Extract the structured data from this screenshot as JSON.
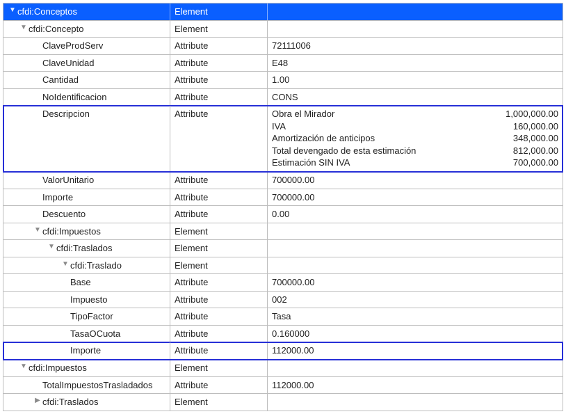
{
  "columns": {
    "c1_header": "cfdi:Conceptos",
    "c2_header": "Element",
    "c3_header": ""
  },
  "rows": [
    {
      "id": "conceptos",
      "indent": 0,
      "arrow": "down",
      "header": true,
      "hl": false,
      "name": "cfdi:Conceptos",
      "type": "Element",
      "value": ""
    },
    {
      "id": "concepto",
      "indent": 1,
      "arrow": "down",
      "header": false,
      "hl": false,
      "name": "cfdi:Concepto",
      "type": "Element",
      "value": ""
    },
    {
      "id": "claveprodserv",
      "indent": 2,
      "arrow": "none",
      "header": false,
      "hl": false,
      "name": "ClaveProdServ",
      "type": "Attribute",
      "value": "72111006"
    },
    {
      "id": "claveunidad",
      "indent": 2,
      "arrow": "none",
      "header": false,
      "hl": false,
      "name": "ClaveUnidad",
      "type": "Attribute",
      "value": "E48"
    },
    {
      "id": "cantidad",
      "indent": 2,
      "arrow": "none",
      "header": false,
      "hl": false,
      "name": "Cantidad",
      "type": "Attribute",
      "value": "1.00"
    },
    {
      "id": "noidentificacion",
      "indent": 2,
      "arrow": "none",
      "header": false,
      "hl": false,
      "name": "NoIdentificacion",
      "type": "Attribute",
      "value": "CONS"
    },
    {
      "id": "descripcion",
      "indent": 2,
      "arrow": "none",
      "header": false,
      "hl": true,
      "name": "Descripcion",
      "type": "Attribute",
      "desc": [
        {
          "k": "Obra el Mirador",
          "v": "1,000,000.00"
        },
        {
          "k": "IVA",
          "v": "160,000.00"
        },
        {
          "k": "Amortización de anticipos",
          "v": "348,000.00"
        },
        {
          "k": "Total devengado de esta estimación",
          "v": "812,000.00"
        },
        {
          "k": "Estimación SIN IVA",
          "v": "700,000.00"
        }
      ]
    },
    {
      "id": "valorunitario",
      "indent": 2,
      "arrow": "none",
      "header": false,
      "hl": false,
      "name": "ValorUnitario",
      "type": "Attribute",
      "value": "700000.00"
    },
    {
      "id": "importe_concepto",
      "indent": 2,
      "arrow": "none",
      "header": false,
      "hl": false,
      "name": "Importe",
      "type": "Attribute",
      "value": "700000.00"
    },
    {
      "id": "descuento",
      "indent": 2,
      "arrow": "none",
      "header": false,
      "hl": false,
      "name": "Descuento",
      "type": "Attribute",
      "value": "0.00"
    },
    {
      "id": "imp_concepto",
      "indent": 2,
      "arrow": "down",
      "header": false,
      "hl": false,
      "name": "cfdi:Impuestos",
      "type": "Element",
      "value": ""
    },
    {
      "id": "traslados_concepto",
      "indent": 3,
      "arrow": "down",
      "header": false,
      "hl": false,
      "name": "cfdi:Traslados",
      "type": "Element",
      "value": ""
    },
    {
      "id": "traslado",
      "indent": 4,
      "arrow": "down",
      "header": false,
      "hl": false,
      "name": "cfdi:Traslado",
      "type": "Element",
      "value": ""
    },
    {
      "id": "base",
      "indent": 4,
      "arrow": "none",
      "header": false,
      "hl": false,
      "name": "Base",
      "type": "Attribute",
      "value": "700000.00"
    },
    {
      "id": "impuesto",
      "indent": 4,
      "arrow": "none",
      "header": false,
      "hl": false,
      "name": "Impuesto",
      "type": "Attribute",
      "value": "002"
    },
    {
      "id": "tipofactor",
      "indent": 4,
      "arrow": "none",
      "header": false,
      "hl": false,
      "name": "TipoFactor",
      "type": "Attribute",
      "value": "Tasa"
    },
    {
      "id": "tasaocuota",
      "indent": 4,
      "arrow": "none",
      "header": false,
      "hl": false,
      "name": "TasaOCuota",
      "type": "Attribute",
      "value": "0.160000"
    },
    {
      "id": "importe_traslado",
      "indent": 4,
      "arrow": "none",
      "header": false,
      "hl": true,
      "name": "Importe",
      "type": "Attribute",
      "value": "112000.00"
    },
    {
      "id": "imp_root",
      "indent": 1,
      "arrow": "down",
      "header": false,
      "hl": false,
      "name": "cfdi:Impuestos",
      "type": "Element",
      "value": ""
    },
    {
      "id": "totalimp",
      "indent": 2,
      "arrow": "none",
      "header": false,
      "hl": false,
      "name": "TotalImpuestosTrasladados",
      "type": "Attribute",
      "value": "112000.00"
    },
    {
      "id": "traslados_root",
      "indent": 2,
      "arrow": "right",
      "header": false,
      "hl": false,
      "name": "cfdi:Traslados",
      "type": "Element",
      "value": ""
    }
  ]
}
